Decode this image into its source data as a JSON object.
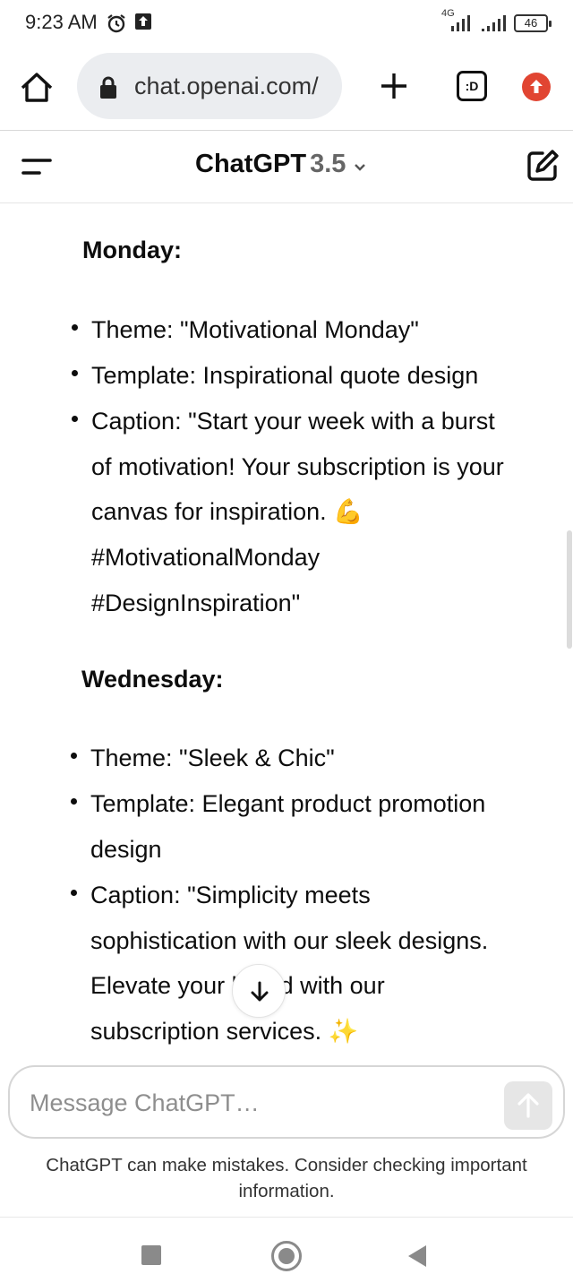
{
  "status_bar": {
    "time": "9:23 AM",
    "network": "4G",
    "battery": "46"
  },
  "browser": {
    "url": "chat.openai.com/",
    "tabs_label": ":D"
  },
  "header": {
    "model_name": "ChatGPT",
    "model_version": "3.5"
  },
  "content": {
    "sections": [
      {
        "heading": "Monday:",
        "items": [
          [
            "Theme: \"Motivational Monday\""
          ],
          [
            "Template: Inspirational quote design"
          ],
          [
            "Caption: \"Start your week with a burst",
            "of motivation! Your subscription is your",
            "canvas for inspiration. 💪",
            "#MotivationalMonday",
            "#DesignInspiration\""
          ]
        ]
      },
      {
        "heading": "Wednesday:",
        "items": [
          [
            "Theme: \"Sleek & Chic\""
          ],
          [
            "Template: Elegant product promotion",
            "design"
          ],
          [
            "Caption: \"Simplicity meets",
            "sophistication with our sleek designs.",
            "Elevate your brand with our",
            "subscription services. ✨"
          ]
        ]
      }
    ]
  },
  "composer": {
    "placeholder": "Message ChatGPT…"
  },
  "footer": {
    "disclaimer": "ChatGPT can make mistakes. Consider checking important information."
  },
  "colors": {
    "update_badge": "#e14532",
    "text": "#0d0d0d",
    "muted_text": "#666666"
  }
}
